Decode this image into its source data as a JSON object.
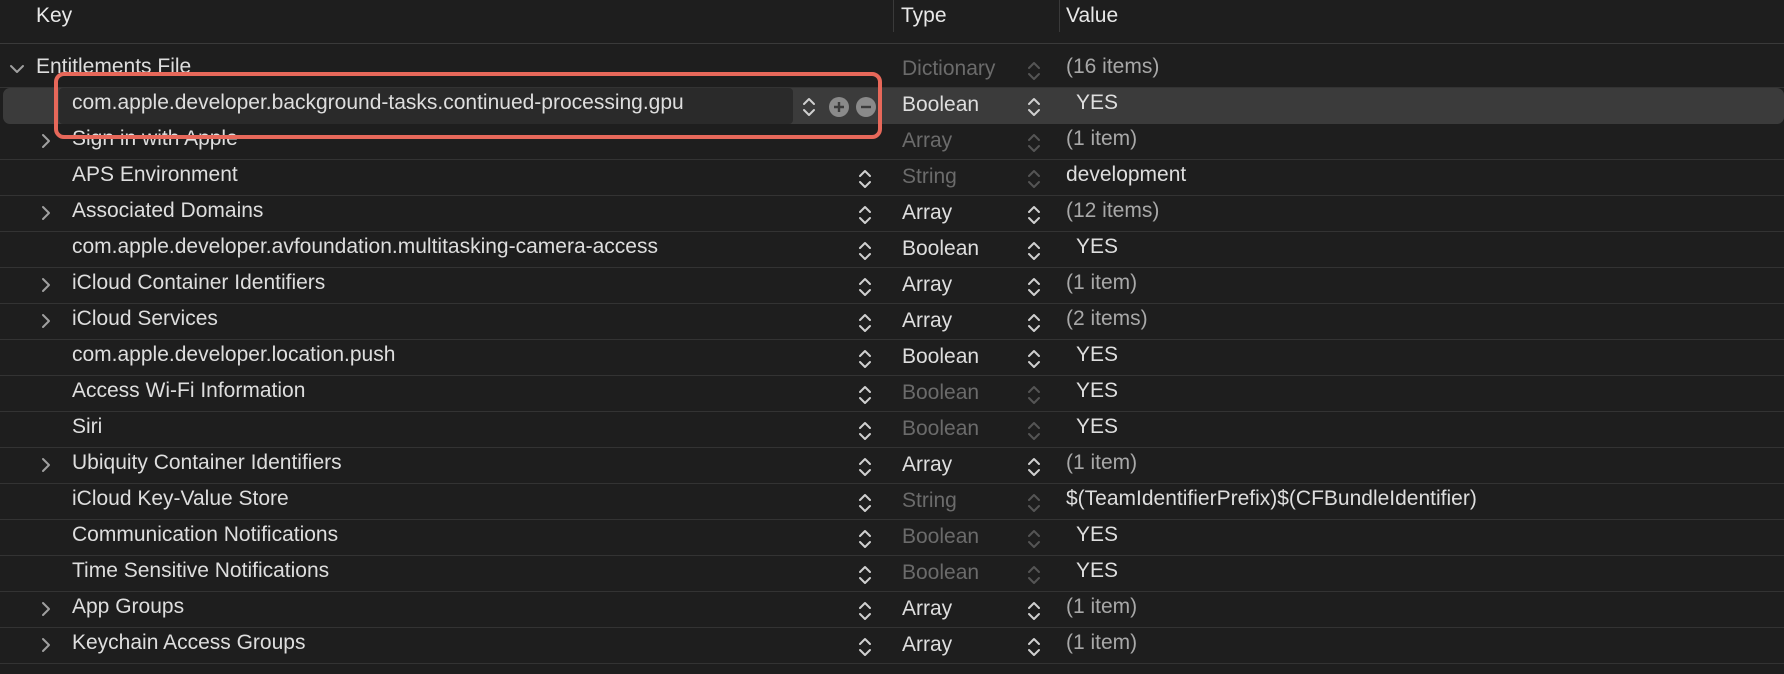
{
  "header": {
    "key_label": "Key",
    "type_label": "Type",
    "value_label": "Value"
  },
  "root": {
    "key": "Entitlements File",
    "type": "Dictionary",
    "value": "(16 items)"
  },
  "rows": [
    {
      "key": "com.apple.developer.background-tasks.continued-processing.gpu",
      "type": "Boolean",
      "value": "YES"
    },
    {
      "key": "Sign in with Apple",
      "type": "Array",
      "value": "(1 item)"
    },
    {
      "key": "APS Environment",
      "type": "String",
      "value": "development"
    },
    {
      "key": "Associated Domains",
      "type": "Array",
      "value": "(12 items)"
    },
    {
      "key": "com.apple.developer.avfoundation.multitasking-camera-access",
      "type": "Boolean",
      "value": "YES"
    },
    {
      "key": "iCloud Container Identifiers",
      "type": "Array",
      "value": "(1 item)"
    },
    {
      "key": "iCloud Services",
      "type": "Array",
      "value": "(2 items)"
    },
    {
      "key": "com.apple.developer.location.push",
      "type": "Boolean",
      "value": "YES"
    },
    {
      "key": "Access Wi-Fi Information",
      "type": "Boolean",
      "value": "YES"
    },
    {
      "key": "Siri",
      "type": "Boolean",
      "value": "YES"
    },
    {
      "key": "Ubiquity Container Identifiers",
      "type": "Array",
      "value": "(1 item)"
    },
    {
      "key": "iCloud Key-Value Store",
      "type": "String",
      "value": "$(TeamIdentifierPrefix)$(CFBundleIdentifier)"
    },
    {
      "key": "Communication Notifications",
      "type": "Boolean",
      "value": "YES"
    },
    {
      "key": "Time Sensitive Notifications",
      "type": "Boolean",
      "value": "YES"
    },
    {
      "key": "App Groups",
      "type": "Array",
      "value": "(1 item)"
    },
    {
      "key": "Keychain Access Groups",
      "type": "Array",
      "value": "(1 item)"
    }
  ],
  "icons": {
    "expand": "chevron-down-icon",
    "collapsed": "chevron-right-icon",
    "stepper": "up-down-stepper-icon",
    "add": "plus-circle-icon",
    "remove": "minus-circle-icon"
  },
  "colors": {
    "background": "#1e1e1e",
    "selected_row": "#3b3b3b",
    "highlight_border": "#e7685a",
    "dim_text": "#6b6b6b"
  }
}
